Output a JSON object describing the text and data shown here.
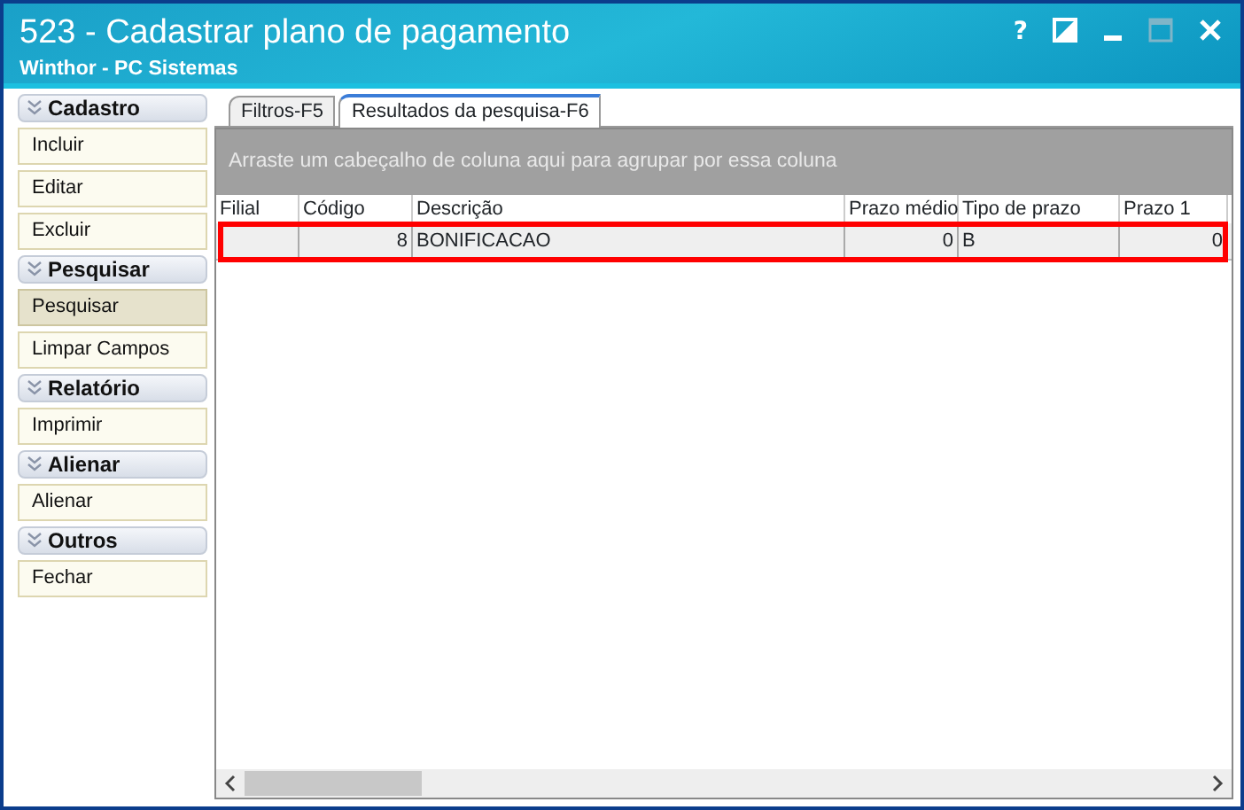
{
  "window": {
    "title": "523 - Cadastrar plano de pagamento",
    "subtitle": "Winthor - PC Sistemas",
    "help": "?"
  },
  "sidebar": [
    {
      "title": "Cadastro",
      "items": [
        {
          "label": "Incluir",
          "selected": false
        },
        {
          "label": "Editar",
          "selected": false
        },
        {
          "label": "Excluir",
          "selected": false
        }
      ]
    },
    {
      "title": "Pesquisar",
      "items": [
        {
          "label": "Pesquisar",
          "selected": true
        },
        {
          "label": "Limpar Campos",
          "selected": false
        }
      ]
    },
    {
      "title": "Relatório",
      "items": [
        {
          "label": "Imprimir",
          "selected": false
        }
      ]
    },
    {
      "title": "Alienar",
      "items": [
        {
          "label": "Alienar",
          "selected": false
        }
      ]
    },
    {
      "title": "Outros",
      "items": [
        {
          "label": "Fechar",
          "selected": false
        }
      ]
    }
  ],
  "tabs": [
    {
      "label": "Filtros-F5",
      "selected": false
    },
    {
      "label": "Resultados da pesquisa-F6",
      "selected": true
    }
  ],
  "group_panel": "Arraste um cabeçalho de coluna aqui para agrupar por essa coluna",
  "table": {
    "columns": [
      "Filial",
      "Código",
      "Descrição",
      "Prazo médio",
      "Tipo de prazo",
      "Prazo 1"
    ],
    "rows": [
      {
        "cells": [
          "",
          "8",
          "BONIFICACAO",
          "0",
          "B",
          "0"
        ]
      }
    ]
  }
}
